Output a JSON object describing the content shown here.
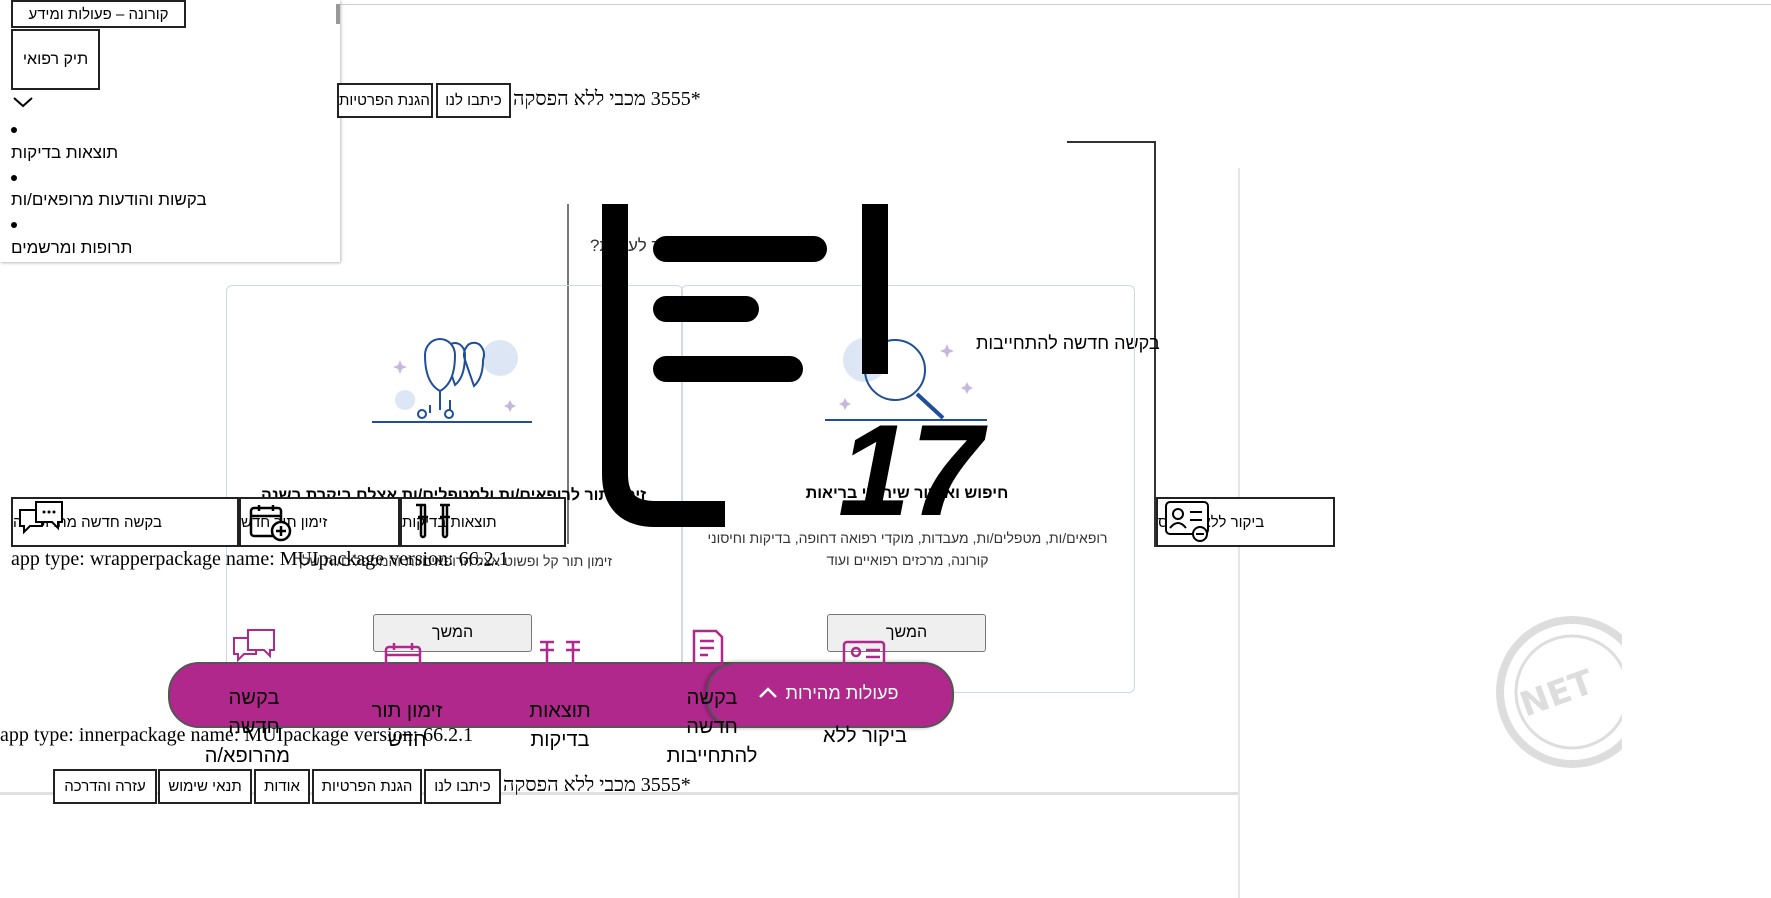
{
  "top_nav": {
    "corona": "קורונה – פעולות ומידע",
    "medical_file": "תיק רפואי",
    "menu": [
      "תוצאות בדיקות",
      "בקשות והודעות מרופאים/ות",
      "תרופות ומרשמים"
    ]
  },
  "header": {
    "privacy": "הגנת הפרטיות",
    "contact": "כיתבו לנו",
    "phone_text": "*3555 מכבי ללא הפסקה"
  },
  "hero": {
    "question": "מה ברצונך לעשות?",
    "request_commitment": "בקשה חדשה להתחייבות",
    "badge_number": "17"
  },
  "cards": [
    {
      "title": "חיפוש ואיתור שירותי בריאות",
      "desc": "רופאים/ות, מטפלים/ות, מעבדות, מוקדי רפואה דחופה, בדיקות וחיסוני קורונה, מרכזים רפואיים ועוד",
      "button": "המשך"
    },
    {
      "title": "זימון תור לרופאים/ות ולמטפלים/ות אצלם ביקרת בשנה האחרונה",
      "desc": "זימון תור קל ופשוט אצל הרופאים/ות והמטפלים/ות שלך",
      "button": "המשך"
    }
  ],
  "action_bar": {
    "no_card_visit": "ביקור ללא כרטיס",
    "test_results": "תוצאות בדיקות",
    "new_appointment": "זימון תור חדש",
    "new_doctor_request": "בקשה חדשה מהרופא/ה"
  },
  "app_info": {
    "wrapper": "app type: wrapperpackage name: MUIpackage version: 66.2.1",
    "inner": "app type: innerpackage name: MUIpackage version: 66.2.1"
  },
  "quick_actions": {
    "toggle": "פעולות מהירות",
    "items": [
      {
        "label": "בקשה חדשה מהרופא/ה"
      },
      {
        "label": "זימון תור חדש"
      },
      {
        "label": "תוצאות בדיקות"
      },
      {
        "label": "בקשה חדשה להתחייבות"
      },
      {
        "label": "ביקור ללא כרטיס"
      }
    ]
  },
  "footer": {
    "help": "עזרה והדרכה",
    "terms": "תנאי שימוש",
    "about": "אודות",
    "privacy": "הגנת הפרטיות",
    "contact": "כיתבו לנו",
    "phone_text": "*3555 מכבי ללא הפסקה"
  },
  "colors": {
    "accent": "#b0288c",
    "illustration": "#1f4e9a",
    "card_border": "#cfd8e6"
  }
}
